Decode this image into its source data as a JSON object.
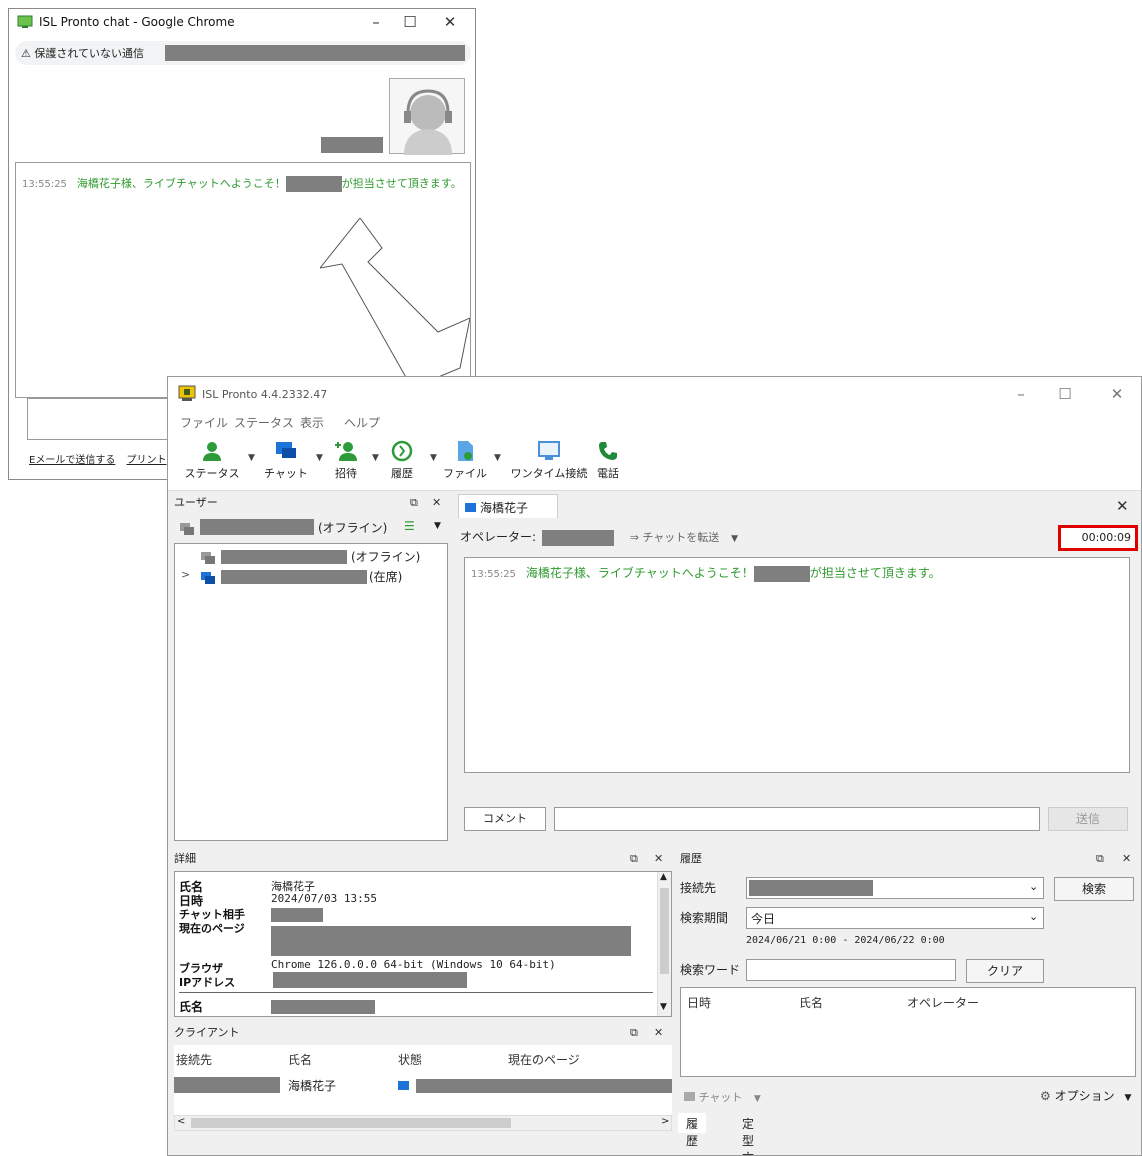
{
  "chrome": {
    "title": "ISL Pronto chat - Google Chrome",
    "warning": "⚠ 保護されていない通信",
    "message_time": "13:55:25",
    "message_text_1": "海橋花子様、ライブチャットへようこそ！",
    "message_text_2": "が担当させて頂きます。",
    "link_email": "Eメールで送信する",
    "link_print": "プリント"
  },
  "pronto": {
    "title": "ISL Pronto 4.4.2332.47",
    "menu": [
      "ファイル",
      "ステータス",
      "表示",
      "ヘルプ"
    ],
    "toolbar": [
      {
        "label": "ステータス",
        "icon": "user-icon"
      },
      {
        "label": "チャット",
        "icon": "chat-icon"
      },
      {
        "label": "招待",
        "icon": "invite-icon"
      },
      {
        "label": "履歴",
        "icon": "history-icon"
      },
      {
        "label": "ファイル",
        "icon": "file-icon"
      },
      {
        "label": "ワンタイム接続",
        "icon": "monitor-icon"
      },
      {
        "label": "電話",
        "icon": "phone-icon"
      }
    ],
    "users": {
      "header": "ユーザー",
      "self_status": "(オフライン)",
      "tree": [
        {
          "status": "(オフライン)"
        },
        {
          "status": "(在席)"
        }
      ]
    },
    "chat": {
      "tab_label": "海橋花子",
      "operator_label": "オペレーター:",
      "transfer_label": "⇒ チャットを転送",
      "timer": "00:00:09",
      "message_time": "13:55:25",
      "message_text_1": "海橋花子様、ライブチャットへようこそ！",
      "message_text_2": "が担当させて頂きます。",
      "comment_button": "コメント",
      "send_button": "送信"
    },
    "details": {
      "header": "詳細",
      "labels": {
        "name": "氏名",
        "datetime": "日時",
        "partner": "チャット相手",
        "page": "現在のページ",
        "browser": "ブラウザ",
        "ip": "IPアドレス",
        "name2": "氏名"
      },
      "values": {
        "name": "海橋花子",
        "datetime": "2024/07/03 13:55",
        "browser": "Chrome 126.0.0.0 64-bit (Windows 10 64-bit)"
      }
    },
    "client": {
      "header": "クライアント",
      "columns": [
        "接続先",
        "氏名",
        "状態",
        "現在のページ"
      ],
      "row_name": "海橋花子"
    },
    "history": {
      "header": "履歴",
      "destination_label": "接続先",
      "search_button": "検索",
      "period_label": "検索期間",
      "period_value": "今日",
      "period_range": "2024/06/21 0:00 - 2024/06/22 0:00",
      "keyword_label": "検索ワード",
      "clear_button": "クリア",
      "columns": [
        "日時",
        "氏名",
        "オペレーター"
      ],
      "chat_button": "チャット",
      "options_button": "オプション",
      "tabs": [
        "履歴",
        "定型文"
      ]
    }
  },
  "colors": {
    "chat_green": "#2f9a2f",
    "highlight_red": "#e00000",
    "toolbar_green": "#2e9b3a",
    "toolbar_blue": "#1e73d8"
  }
}
